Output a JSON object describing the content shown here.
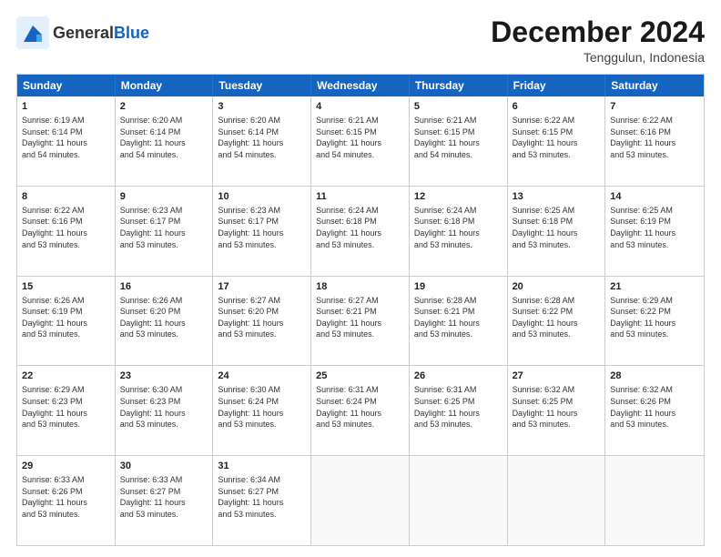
{
  "header": {
    "logo_general": "General",
    "logo_blue": "Blue",
    "month_title": "December 2024",
    "subtitle": "Tenggulun, Indonesia"
  },
  "days_of_week": [
    "Sunday",
    "Monday",
    "Tuesday",
    "Wednesday",
    "Thursday",
    "Friday",
    "Saturday"
  ],
  "weeks": [
    [
      {
        "day": "1",
        "lines": [
          "Sunrise: 6:19 AM",
          "Sunset: 6:14 PM",
          "Daylight: 11 hours",
          "and 54 minutes."
        ]
      },
      {
        "day": "2",
        "lines": [
          "Sunrise: 6:20 AM",
          "Sunset: 6:14 PM",
          "Daylight: 11 hours",
          "and 54 minutes."
        ]
      },
      {
        "day": "3",
        "lines": [
          "Sunrise: 6:20 AM",
          "Sunset: 6:14 PM",
          "Daylight: 11 hours",
          "and 54 minutes."
        ]
      },
      {
        "day": "4",
        "lines": [
          "Sunrise: 6:21 AM",
          "Sunset: 6:15 PM",
          "Daylight: 11 hours",
          "and 54 minutes."
        ]
      },
      {
        "day": "5",
        "lines": [
          "Sunrise: 6:21 AM",
          "Sunset: 6:15 PM",
          "Daylight: 11 hours",
          "and 54 minutes."
        ]
      },
      {
        "day": "6",
        "lines": [
          "Sunrise: 6:22 AM",
          "Sunset: 6:15 PM",
          "Daylight: 11 hours",
          "and 53 minutes."
        ]
      },
      {
        "day": "7",
        "lines": [
          "Sunrise: 6:22 AM",
          "Sunset: 6:16 PM",
          "Daylight: 11 hours",
          "and 53 minutes."
        ]
      }
    ],
    [
      {
        "day": "8",
        "lines": [
          "Sunrise: 6:22 AM",
          "Sunset: 6:16 PM",
          "Daylight: 11 hours",
          "and 53 minutes."
        ]
      },
      {
        "day": "9",
        "lines": [
          "Sunrise: 6:23 AM",
          "Sunset: 6:17 PM",
          "Daylight: 11 hours",
          "and 53 minutes."
        ]
      },
      {
        "day": "10",
        "lines": [
          "Sunrise: 6:23 AM",
          "Sunset: 6:17 PM",
          "Daylight: 11 hours",
          "and 53 minutes."
        ]
      },
      {
        "day": "11",
        "lines": [
          "Sunrise: 6:24 AM",
          "Sunset: 6:18 PM",
          "Daylight: 11 hours",
          "and 53 minutes."
        ]
      },
      {
        "day": "12",
        "lines": [
          "Sunrise: 6:24 AM",
          "Sunset: 6:18 PM",
          "Daylight: 11 hours",
          "and 53 minutes."
        ]
      },
      {
        "day": "13",
        "lines": [
          "Sunrise: 6:25 AM",
          "Sunset: 6:18 PM",
          "Daylight: 11 hours",
          "and 53 minutes."
        ]
      },
      {
        "day": "14",
        "lines": [
          "Sunrise: 6:25 AM",
          "Sunset: 6:19 PM",
          "Daylight: 11 hours",
          "and 53 minutes."
        ]
      }
    ],
    [
      {
        "day": "15",
        "lines": [
          "Sunrise: 6:26 AM",
          "Sunset: 6:19 PM",
          "Daylight: 11 hours",
          "and 53 minutes."
        ]
      },
      {
        "day": "16",
        "lines": [
          "Sunrise: 6:26 AM",
          "Sunset: 6:20 PM",
          "Daylight: 11 hours",
          "and 53 minutes."
        ]
      },
      {
        "day": "17",
        "lines": [
          "Sunrise: 6:27 AM",
          "Sunset: 6:20 PM",
          "Daylight: 11 hours",
          "and 53 minutes."
        ]
      },
      {
        "day": "18",
        "lines": [
          "Sunrise: 6:27 AM",
          "Sunset: 6:21 PM",
          "Daylight: 11 hours",
          "and 53 minutes."
        ]
      },
      {
        "day": "19",
        "lines": [
          "Sunrise: 6:28 AM",
          "Sunset: 6:21 PM",
          "Daylight: 11 hours",
          "and 53 minutes."
        ]
      },
      {
        "day": "20",
        "lines": [
          "Sunrise: 6:28 AM",
          "Sunset: 6:22 PM",
          "Daylight: 11 hours",
          "and 53 minutes."
        ]
      },
      {
        "day": "21",
        "lines": [
          "Sunrise: 6:29 AM",
          "Sunset: 6:22 PM",
          "Daylight: 11 hours",
          "and 53 minutes."
        ]
      }
    ],
    [
      {
        "day": "22",
        "lines": [
          "Sunrise: 6:29 AM",
          "Sunset: 6:23 PM",
          "Daylight: 11 hours",
          "and 53 minutes."
        ]
      },
      {
        "day": "23",
        "lines": [
          "Sunrise: 6:30 AM",
          "Sunset: 6:23 PM",
          "Daylight: 11 hours",
          "and 53 minutes."
        ]
      },
      {
        "day": "24",
        "lines": [
          "Sunrise: 6:30 AM",
          "Sunset: 6:24 PM",
          "Daylight: 11 hours",
          "and 53 minutes."
        ]
      },
      {
        "day": "25",
        "lines": [
          "Sunrise: 6:31 AM",
          "Sunset: 6:24 PM",
          "Daylight: 11 hours",
          "and 53 minutes."
        ]
      },
      {
        "day": "26",
        "lines": [
          "Sunrise: 6:31 AM",
          "Sunset: 6:25 PM",
          "Daylight: 11 hours",
          "and 53 minutes."
        ]
      },
      {
        "day": "27",
        "lines": [
          "Sunrise: 6:32 AM",
          "Sunset: 6:25 PM",
          "Daylight: 11 hours",
          "and 53 minutes."
        ]
      },
      {
        "day": "28",
        "lines": [
          "Sunrise: 6:32 AM",
          "Sunset: 6:26 PM",
          "Daylight: 11 hours",
          "and 53 minutes."
        ]
      }
    ],
    [
      {
        "day": "29",
        "lines": [
          "Sunrise: 6:33 AM",
          "Sunset: 6:26 PM",
          "Daylight: 11 hours",
          "and 53 minutes."
        ]
      },
      {
        "day": "30",
        "lines": [
          "Sunrise: 6:33 AM",
          "Sunset: 6:27 PM",
          "Daylight: 11 hours",
          "and 53 minutes."
        ]
      },
      {
        "day": "31",
        "lines": [
          "Sunrise: 6:34 AM",
          "Sunset: 6:27 PM",
          "Daylight: 11 hours",
          "and 53 minutes."
        ]
      },
      {
        "day": "",
        "lines": []
      },
      {
        "day": "",
        "lines": []
      },
      {
        "day": "",
        "lines": []
      },
      {
        "day": "",
        "lines": []
      }
    ]
  ]
}
